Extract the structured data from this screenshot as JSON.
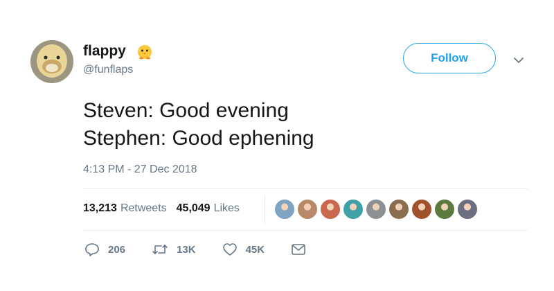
{
  "user": {
    "display_name": "flappy",
    "name_emoji": "chick-emoji",
    "handle": "@funflaps",
    "avatar": "duckling-avatar"
  },
  "follow_button": {
    "label": "Follow"
  },
  "menu_icon": "chevron-down-icon",
  "tweet": {
    "lines": [
      "Steven: Good evening",
      "Stephen: Good ephening"
    ],
    "timestamp": "4:13 PM - 27 Dec 2018"
  },
  "stats": {
    "retweets_count": "13,213",
    "retweets_label": "Retweets",
    "likes_count": "45,049",
    "likes_label": "Likes"
  },
  "likers": [
    {
      "icon": "seagull-avatar",
      "color": "#7fa3c2"
    },
    {
      "icon": "street-avatar",
      "color": "#b98a6a"
    },
    {
      "icon": "person-avatar",
      "color": "#c9684f"
    },
    {
      "icon": "person-avatar",
      "color": "#3fa0a8"
    },
    {
      "icon": "group-avatar",
      "color": "#8c8f94"
    },
    {
      "icon": "person-avatar",
      "color": "#8a6e4e"
    },
    {
      "icon": "crowd-avatar",
      "color": "#a0522d"
    },
    {
      "icon": "person-avatar",
      "color": "#5b7a3d"
    },
    {
      "icon": "person-avatar",
      "color": "#6b6f80"
    }
  ],
  "actions": {
    "reply_count": "206",
    "retweet_count": "13K",
    "like_count": "45K"
  },
  "colors": {
    "accent": "#1da1f2",
    "text": "#14171a",
    "muted": "#657786",
    "divider": "#e6ecf0"
  }
}
